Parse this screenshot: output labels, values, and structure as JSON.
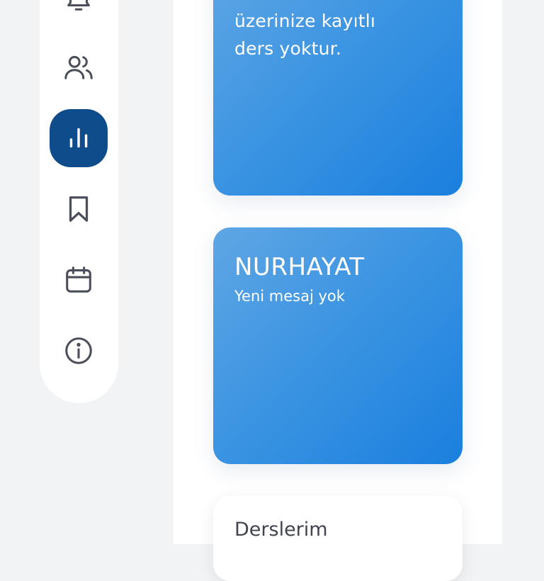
{
  "sidebar": {
    "items": [
      {
        "icon": "bell-icon",
        "active": false
      },
      {
        "icon": "users-icon",
        "active": false
      },
      {
        "icon": "bar-chart-icon",
        "active": true
      },
      {
        "icon": "bookmark-icon",
        "active": false
      },
      {
        "icon": "calendar-icon",
        "active": false
      },
      {
        "icon": "info-icon",
        "active": false
      }
    ]
  },
  "cards": {
    "courses_info": {
      "line1": "üzerinize kayıtlı",
      "line2": "ders yoktur."
    },
    "messages": {
      "title": "NURHAYAT",
      "subtitle": "Yeni mesaj yok"
    },
    "my_courses": {
      "title": "Derslerim"
    }
  },
  "colors": {
    "active_nav": "#0f4c8c",
    "card_gradient_start": "#5fa6e4",
    "card_gradient_end": "#1a7fde",
    "icon_gray": "#4a4f5a"
  }
}
